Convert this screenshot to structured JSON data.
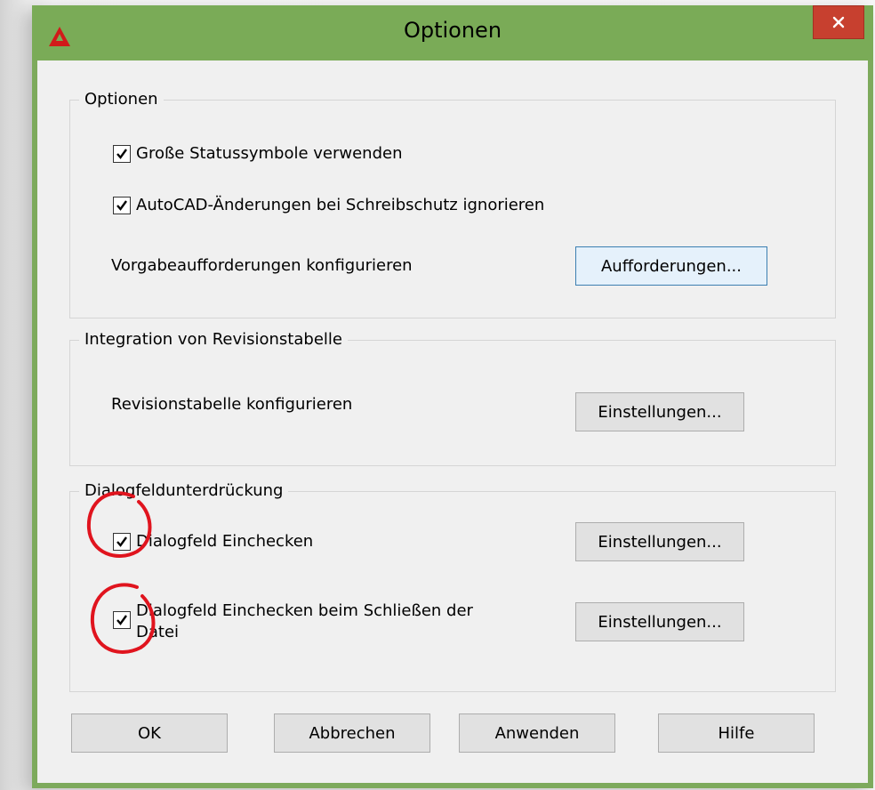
{
  "window": {
    "title": "Optionen",
    "close_symbol": "✕"
  },
  "colors": {
    "titlebar": "#7aab57",
    "close": "#c7402f",
    "app_icon": "#d11a1a",
    "annotation": "#e0141e"
  },
  "group_options": {
    "title": "Optionen",
    "check_large_icons": "Große Statussymbole verwenden",
    "check_ignore_readonly": "AutoCAD-Änderungen bei Schreibschutz ignorieren",
    "prompts_label": "Vorgabeaufforderungen konfigurieren",
    "prompts_button": "Aufforderungen..."
  },
  "group_revision": {
    "title": "Integration von Revisionstabelle",
    "config_label": "Revisionstabelle konfigurieren",
    "settings_button": "Einstellungen..."
  },
  "group_suppress": {
    "title": "Dialogfeldunterdrückung",
    "check_checkin": "Dialogfeld Einchecken",
    "check_checkin_close_line1": "Dialogfeld Einchecken beim Schließen der",
    "check_checkin_close_line2": "Datei",
    "settings_button_1": "Einstellungen...",
    "settings_button_2": "Einstellungen..."
  },
  "footer": {
    "ok": "OK",
    "cancel": "Abbrechen",
    "apply": "Anwenden",
    "help": "Hilfe"
  }
}
